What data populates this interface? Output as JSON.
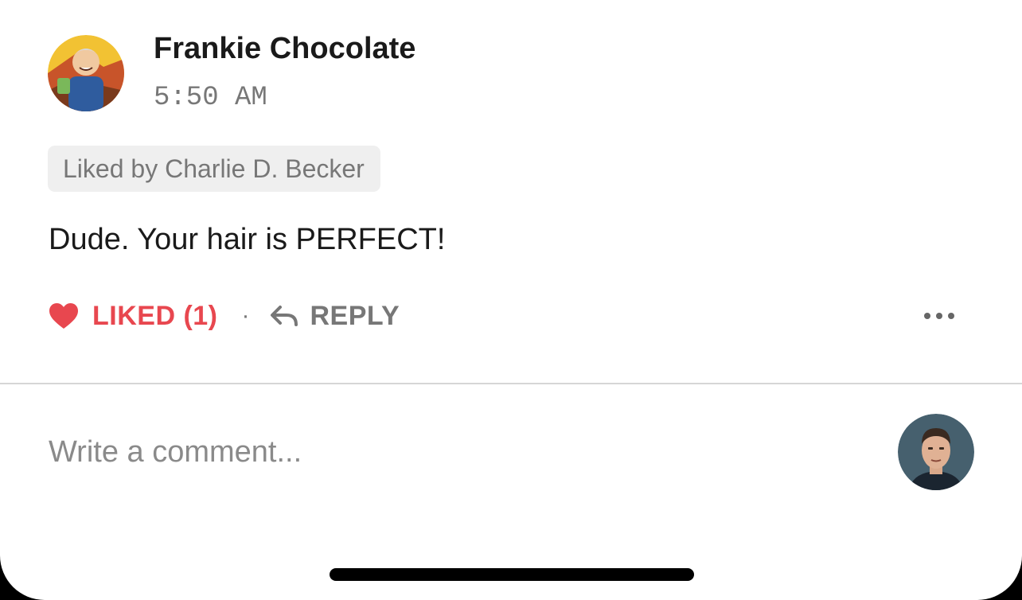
{
  "comment": {
    "author_name": "Frankie Chocolate",
    "timestamp": "5:50 AM",
    "liked_by": "Liked by Charlie D. Becker",
    "body": "Dude. Your hair is PERFECT!"
  },
  "actions": {
    "like_label": "LIKED (1)",
    "like_icon": "heart-icon",
    "separator": "·",
    "reply_label": "REPLY",
    "reply_icon": "reply-arrow-icon",
    "more_icon": "ellipsis-icon"
  },
  "composer": {
    "placeholder": "Write a comment..."
  },
  "colors": {
    "liked_accent": "#e8474f",
    "muted_text": "#777777",
    "badge_background": "#efefef",
    "divider": "#d6d6d6"
  }
}
